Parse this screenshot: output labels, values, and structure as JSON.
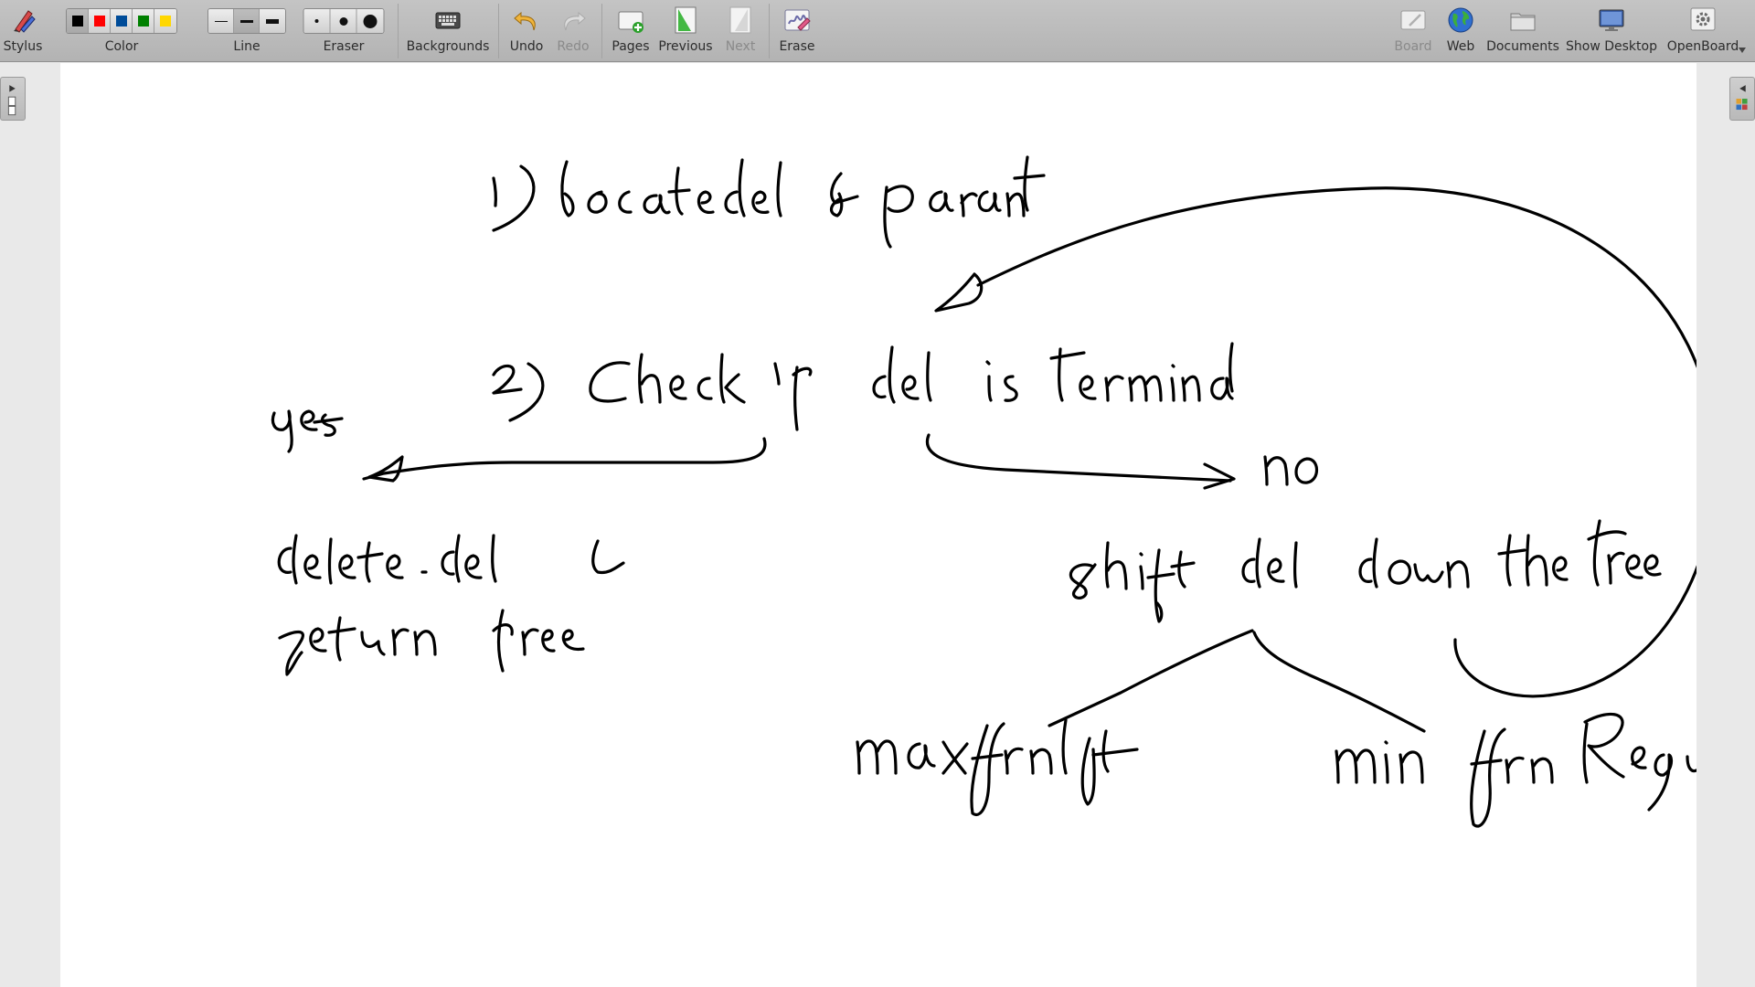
{
  "toolbar": {
    "stylus": {
      "label": "Stylus",
      "icon": "stylus-icon"
    },
    "color": {
      "label": "Color",
      "swatches": [
        "#000000",
        "#ff0000",
        "#004c99",
        "#008000",
        "#ffd700"
      ],
      "selected": 0
    },
    "line": {
      "label": "Line"
    },
    "eraser": {
      "label": "Eraser"
    },
    "backgrounds": {
      "label": "Backgrounds",
      "icon": "keyboard-icon"
    },
    "undo": {
      "label": "Undo",
      "icon": "undo-arrow-icon"
    },
    "redo": {
      "label": "Redo",
      "icon": "redo-arrow-icon",
      "disabled": true
    },
    "pages": {
      "label": "Pages",
      "icon": "add-page-icon"
    },
    "previous": {
      "label": "Previous",
      "icon": "previous-page-icon"
    },
    "next": {
      "label": "Next",
      "icon": "next-page-icon",
      "disabled": true
    },
    "erase": {
      "label": "Erase",
      "icon": "erase-board-icon"
    },
    "board": {
      "label": "Board",
      "icon": "board-icon",
      "disabled": true
    },
    "web": {
      "label": "Web",
      "icon": "globe-icon"
    },
    "documents": {
      "label": "Documents",
      "icon": "folder-icon"
    },
    "show_desktop": {
      "label": "Show Desktop",
      "icon": "monitor-icon"
    },
    "openboard": {
      "label": "OpenBoard",
      "icon": "gear-icon"
    }
  },
  "board": {
    "handwriting": [
      "1) locate del & parent",
      "2) Check if del is terminal",
      "yes",
      "no",
      "delete del & return tree",
      "shift del down the tree",
      "max from left",
      "min from Right"
    ]
  }
}
